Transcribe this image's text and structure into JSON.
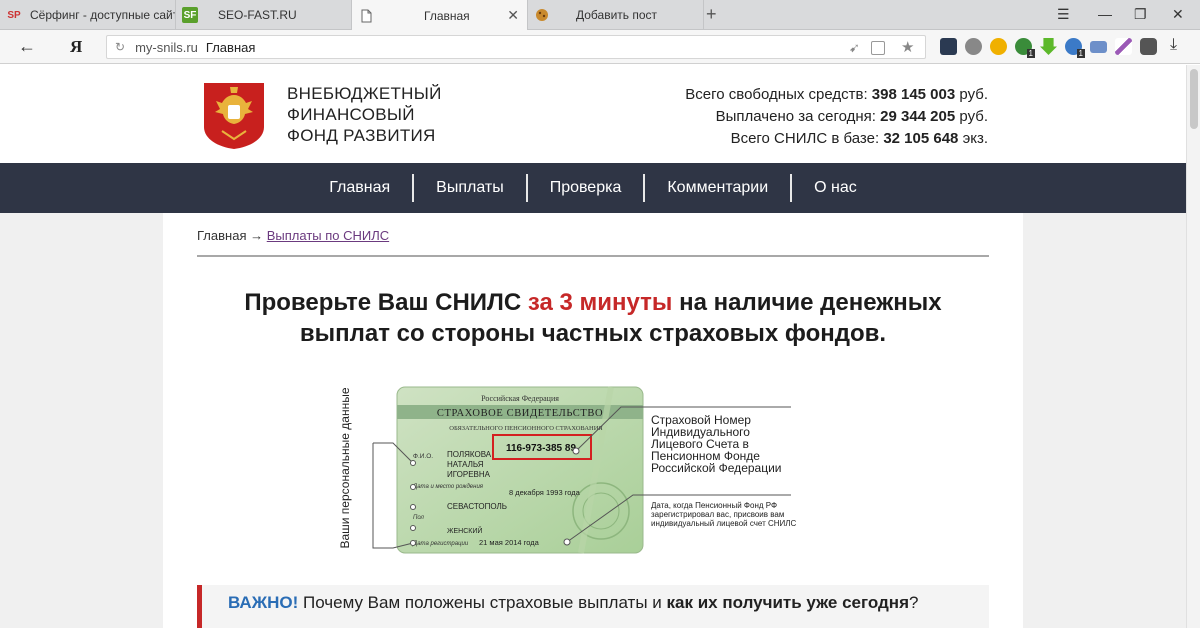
{
  "browser": {
    "tabs": [
      {
        "favicon": "SP",
        "label": "Сёрфинг - доступные сайть",
        "active": false
      },
      {
        "favicon": "SF",
        "label": "SEO-FAST.RU",
        "active": false
      },
      {
        "favicon": "page-icon",
        "label": "Главная",
        "active": true
      },
      {
        "favicon": "cookie-icon",
        "label": "Добавить пост",
        "active": false
      }
    ],
    "address": {
      "domain": "my-snils.ru",
      "page_title": "Главная"
    },
    "yandex_logo": "Я",
    "ext_badge_1": "1",
    "ext_badge_2": "1"
  },
  "site": {
    "brand": {
      "line1": "ВНЕБЮДЖЕТНЫЙ",
      "line2": "ФИНАНСОВЫЙ",
      "line3": "ФОНД РАЗВИТИЯ"
    },
    "stats": [
      {
        "label": "Всего свободных средств:",
        "value": "398 145 003",
        "unit": "руб."
      },
      {
        "label": "Выплачено за сегодня:",
        "value": "29 344 205",
        "unit": "руб."
      },
      {
        "label": "Всего СНИЛС в базе:",
        "value": "32 105 648",
        "unit": "экз."
      }
    ],
    "nav": [
      "Главная",
      "Выплаты",
      "Проверка",
      "Комментарии",
      "О нас"
    ],
    "breadcrumb": {
      "home": "Главная",
      "arrow": "→",
      "current": "Выплаты по СНИЛС"
    },
    "headline": {
      "part1": "Проверьте Ваш СНИЛС",
      "highlight": "за 3 минуты",
      "part2": "на наличие денежных выплат со стороны частных страховых фондов."
    },
    "card": {
      "country": "Российская Федерация",
      "title": "СТРАХОВОЕ СВИДЕТЕЛЬСТВО",
      "subtitle": "ОБЯЗАТЕЛЬНОГО ПЕНСИОННОГО СТРАХОВАНИЯ",
      "number": "116-973-385 89",
      "fio_label": "Ф.И.О.",
      "fio_line1": "ПОЛЯКОВА",
      "fio_line2": "НАТАЛЬЯ",
      "fio_line3": "ИГОРЕВНА",
      "birth_label": "Дата и место рождения",
      "birth_date": "8 декабря 1993 года",
      "birth_place": "СЕВАСТОПОЛЬ",
      "sex_label": "Пол",
      "sex": "ЖЕНСКИЙ",
      "reg_label": "Дата регистрации",
      "reg_date": "21 мая 2014 года",
      "side_label": "Ваши персональные данные",
      "callout_number": "Страховой Номер Индивидуального Лицевого Счета в Пенсионном Фонде Российской Федерации",
      "callout_date": "Дата, когда Пенсионный Фонд РФ зарегистрировал вас, присвоив вам индивидуальный лицевой счет СНИЛС"
    },
    "important": {
      "lead": "ВАЖНО!",
      "text1": "Почему Вам положены страховые выплаты и",
      "bold": "как их получить уже сегодня",
      "end": "?"
    }
  }
}
